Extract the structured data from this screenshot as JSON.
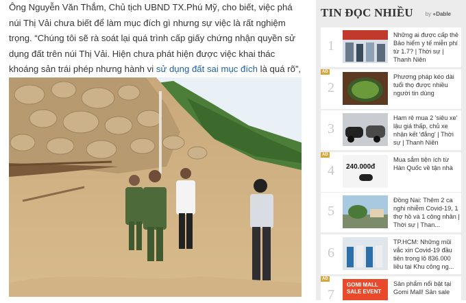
{
  "article": {
    "paragraph_before_link": "Ông Nguyễn Văn Thắm, Chủ tịch UBND TX.Phú Mỹ, cho biết, việc phá núi Thị Vải chưa biết để làm mục đích gì nhưng sự việc là rất nghiệm trọng. “Chúng tôi sẽ rà soát lại quá trình cấp giấy chứng nhận quyền sử dụng đất trên núi Thị Vải. Hiện chưa phát hiện được việc khai thác khoáng sản trái phép nhưng hành vi ",
    "link_text": "sử dụng đất sai mục đích",
    "paragraph_after_link": " là quá rõ”, ông Thắm nói."
  },
  "sidebar": {
    "title": "TIN ĐỌC NHIỀU",
    "brand_by": "by",
    "brand_name": "Dable",
    "ad_label": "AD",
    "items": [
      {
        "rank": "1",
        "text": "Những ai được cấp thẻ Bảo hiểm y tế miễn phí từ 1.7? | Thời sự | Thanh Niên"
      },
      {
        "rank": "2",
        "text": "Phương pháp kéo dài tuổi thọ được nhiều người tin dùng"
      },
      {
        "rank": "3",
        "text": "Ham rẻ mua 2 'siêu xe' lậu giá thấp, chủ xe nhận kết 'đắng' | Thời sự | Thanh Niên"
      },
      {
        "rank": "4",
        "text": "Mua sắm tiện ích từ Hàn Quốc về tận nhà",
        "thumb_price": "240.000đ"
      },
      {
        "rank": "5",
        "text": "Đồng Nai: Thêm 2 ca nghi nhiễm Covid-19, 1 thợ hồ và 1 công nhân | Thời sự | Than..."
      },
      {
        "rank": "6",
        "text": "TP.HCM: Những mũi vắc xin Covid-19 đầu tiên trong lô 836.000 liều tại Khu công ng..."
      },
      {
        "rank": "7",
        "text": "Sản phẩm nổi bật tại Gomi Mall! Sản sale",
        "thumb_label_1": "GOMI MALL",
        "thumb_label_2": "SALE EVENT"
      }
    ]
  },
  "colors": {
    "link": "#1f62a8",
    "sidebar_bg": "#ececec",
    "rank": "#c9c9c9"
  }
}
